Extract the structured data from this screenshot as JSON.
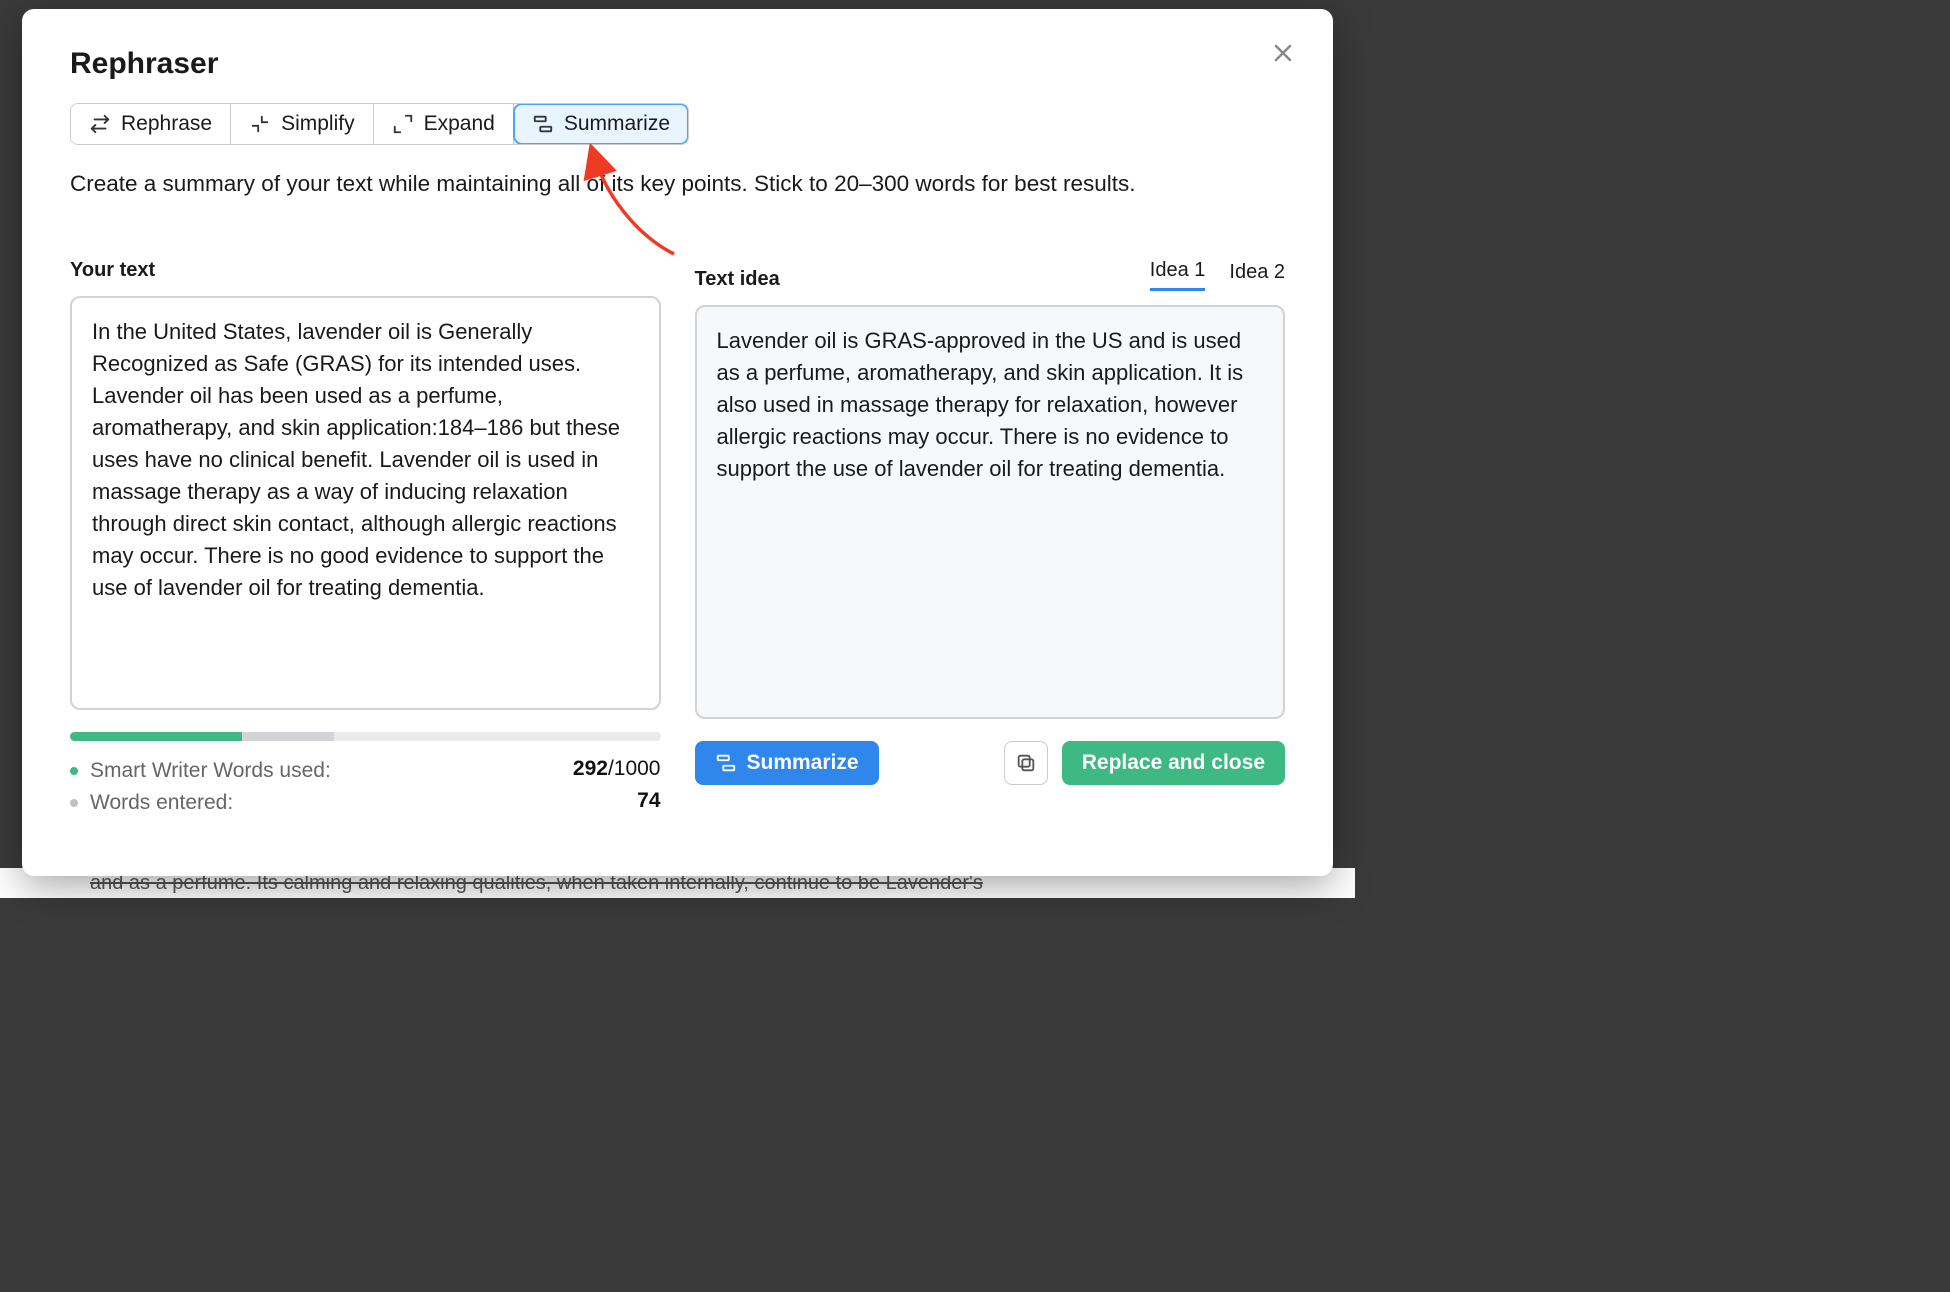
{
  "title": "Rephraser",
  "tabs": [
    {
      "label": "Rephrase",
      "icon": "rephrase"
    },
    {
      "label": "Simplify",
      "icon": "simplify"
    },
    {
      "label": "Expand",
      "icon": "expand"
    },
    {
      "label": "Summarize",
      "icon": "summarize",
      "active": true
    }
  ],
  "description": "Create a summary of your text while maintaining all of its key points. Stick to 20–300 words for best results.",
  "left": {
    "heading": "Your text",
    "body": "In the United States, lavender oil is Generally Recognized as Safe (GRAS) for its intended uses. Lavender oil has been used as a perfume, aromatherapy, and skin application:184–186 but these uses have no clinical benefit. Lavender oil is used in massage therapy as a way of inducing relaxation through direct skin contact, although allergic reactions may occur. There is no good evidence to support the use of lavender oil for treating dementia."
  },
  "right": {
    "heading": "Text idea",
    "ideas": [
      {
        "label": "Idea 1",
        "active": true
      },
      {
        "label": "Idea 2",
        "active": false
      }
    ],
    "body": "Lavender oil is GRAS-approved in the US and is used as a perfume, aromatherapy, and skin application. It is also used in massage therapy for relaxation, however allergic reactions may occur. There is no evidence to support the use of lavender oil for treating dementia."
  },
  "progress": {
    "green_pct": 29.2,
    "gray_pct": 15.5
  },
  "stats": {
    "used_label": "Smart Writer Words used:",
    "used_value": "292",
    "used_cap": "/1000",
    "entered_label": "Words entered:",
    "entered_value": "74"
  },
  "actions": {
    "summarize": "Summarize",
    "copy_icon_title": "Copy",
    "replace": "Replace and close"
  },
  "colors": {
    "accent_blue": "#2f86eb",
    "accent_green": "#3fb984"
  },
  "bg_fragment": "and as a perfume. Its calming and relaxing qualities, when taken internally, continue to be Lavender's"
}
